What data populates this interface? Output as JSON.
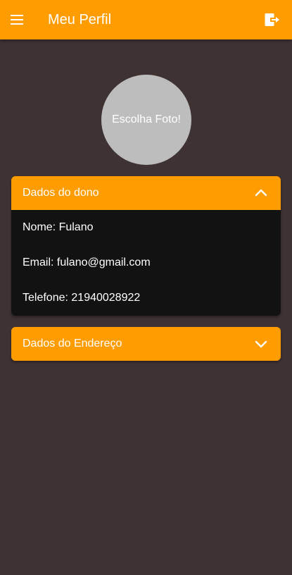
{
  "appbar": {
    "title": "Meu Perfil",
    "menu_icon": "menu-icon",
    "logout_icon": "logout-icon",
    "color": "#ff9c00"
  },
  "avatar": {
    "label": "Escolha Foto!",
    "color": "#bdbdbd"
  },
  "owner_panel": {
    "title": "Dados do dono",
    "expanded": true,
    "rows": [
      {
        "label": "Nome:",
        "value": "Fulano"
      },
      {
        "label": "Email:",
        "value": "fulano@gmail.com"
      },
      {
        "label": "Telefone:",
        "value": "21940028922"
      }
    ]
  },
  "address_panel": {
    "title": "Dados do Endereço",
    "expanded": false
  },
  "colors": {
    "background": "#3e3232",
    "panel_body": "#121212",
    "accent": "#ff9c00"
  }
}
